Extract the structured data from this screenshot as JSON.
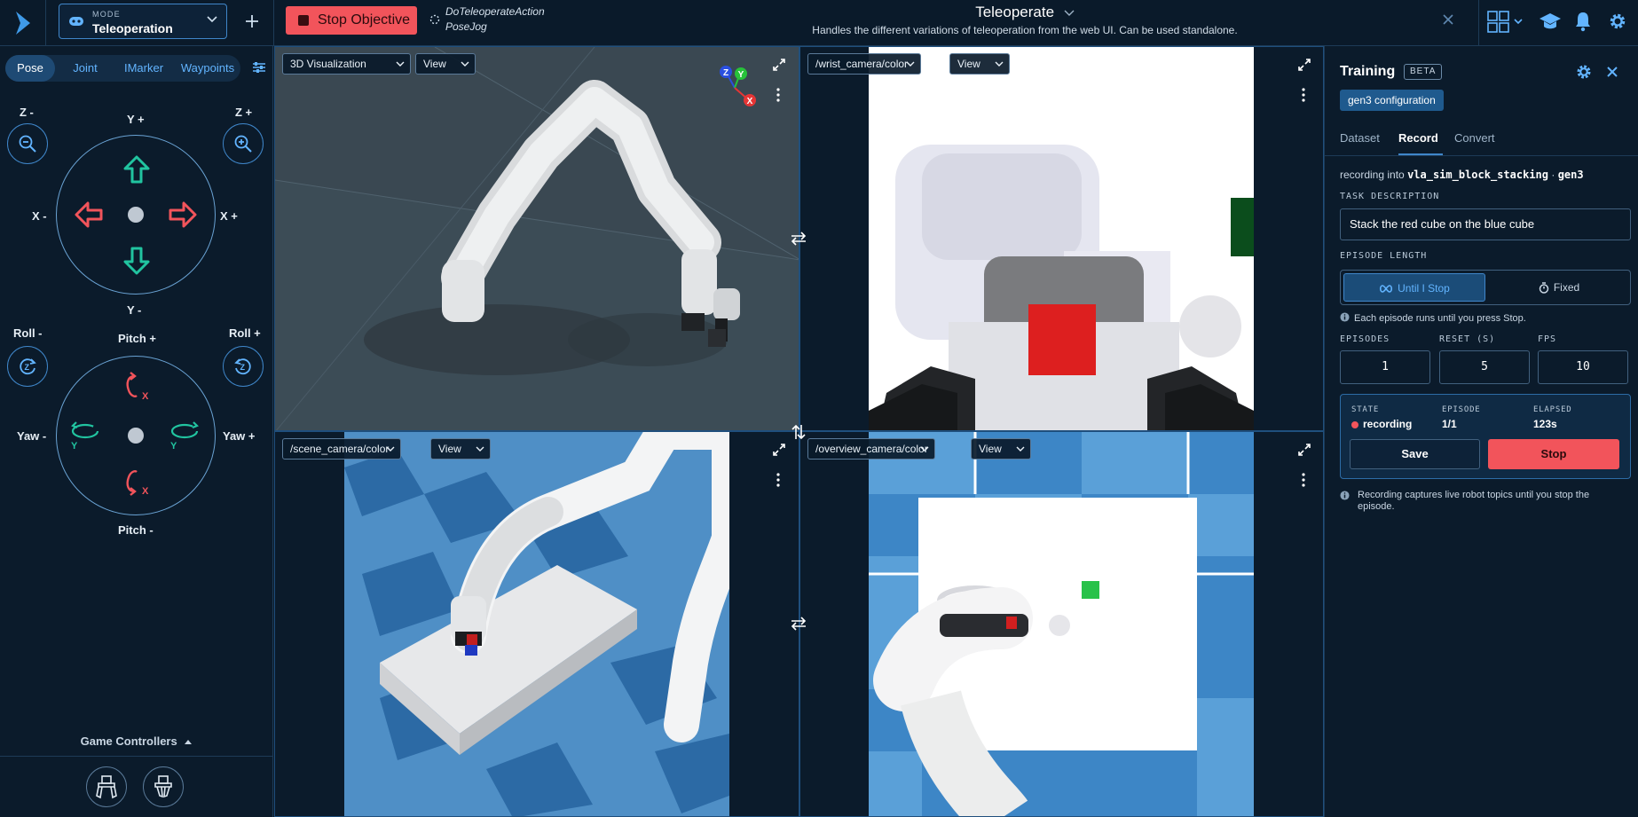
{
  "topbar": {
    "mode_label": "MODE",
    "mode_value": "Teleoperation",
    "stop_objective_label": "Stop Objective",
    "action_line1": "DoTeleoperateAction",
    "action_line2": "PoseJog",
    "title": "Teleoperate",
    "subtitle": "Handles the different variations of teleoperation from the web UI. Can be used standalone."
  },
  "left_panel": {
    "tabs": [
      "Pose",
      "Joint",
      "IMarker",
      "Waypoints"
    ],
    "active_tab": "Pose",
    "translation": {
      "z_minus": "Z -",
      "z_plus": "Z +",
      "y_plus": "Y +",
      "y_minus": "Y -",
      "x_minus": "X -",
      "x_plus": "X +"
    },
    "rotation": {
      "roll_minus": "Roll -",
      "roll_plus": "Roll +",
      "pitch_plus": "Pitch +",
      "pitch_minus": "Pitch -",
      "yaw_minus": "Yaw -",
      "yaw_plus": "Yaw +",
      "axis_x": "X",
      "axis_y": "Y",
      "axis_z": "Z"
    },
    "game_controllers_label": "Game Controllers"
  },
  "viewports": {
    "top_left": {
      "source": "3D Visualization",
      "view": "View",
      "gizmo_z": "Z",
      "gizmo_y": "Y",
      "gizmo_x": "X"
    },
    "top_right": {
      "source": "/wrist_camera/color",
      "view": "View"
    },
    "bottom_left": {
      "source": "/scene_camera/color",
      "view": "View"
    },
    "bottom_right": {
      "source": "/overview_camera/color",
      "view": "View"
    }
  },
  "training": {
    "title": "Training",
    "badge": "BETA",
    "config_chip": "gen3 configuration",
    "tabs": [
      "Dataset",
      "Record",
      "Convert"
    ],
    "active_tab": "Record",
    "recording_into_prefix": "recording into",
    "dataset_name": "vla_sim_block_stacking",
    "dot_sep": "·",
    "config_name": "gen3",
    "task_description_label": "TASK DESCRIPTION",
    "task_description_value": "Stack the red cube on the blue cube",
    "episode_length_label": "EPISODE LENGTH",
    "until_stop_label": "Until I Stop",
    "fixed_label": "Fixed",
    "episode_hint": "Each episode runs until you press Stop.",
    "episodes_label": "EPISODES",
    "episodes_value": "1",
    "reset_label": "RESET (S)",
    "reset_value": "5",
    "fps_label": "FPS",
    "fps_value": "10",
    "state_label": "STATE",
    "state_value": "recording",
    "episode_label": "EPISODE",
    "episode_value": "1/1",
    "elapsed_label": "ELAPSED",
    "elapsed_value": "123s",
    "save_label": "Save",
    "stop_label": "Stop",
    "footer_hint": "Recording captures live robot topics until you stop the episode."
  },
  "colors": {
    "accent": "#3f86c9",
    "accent_text": "#62b4ff",
    "danger": "#f2545b",
    "teal_arrow": "#21c4a0",
    "red_arrow": "#f2545b",
    "background": "#0b1b2b"
  }
}
